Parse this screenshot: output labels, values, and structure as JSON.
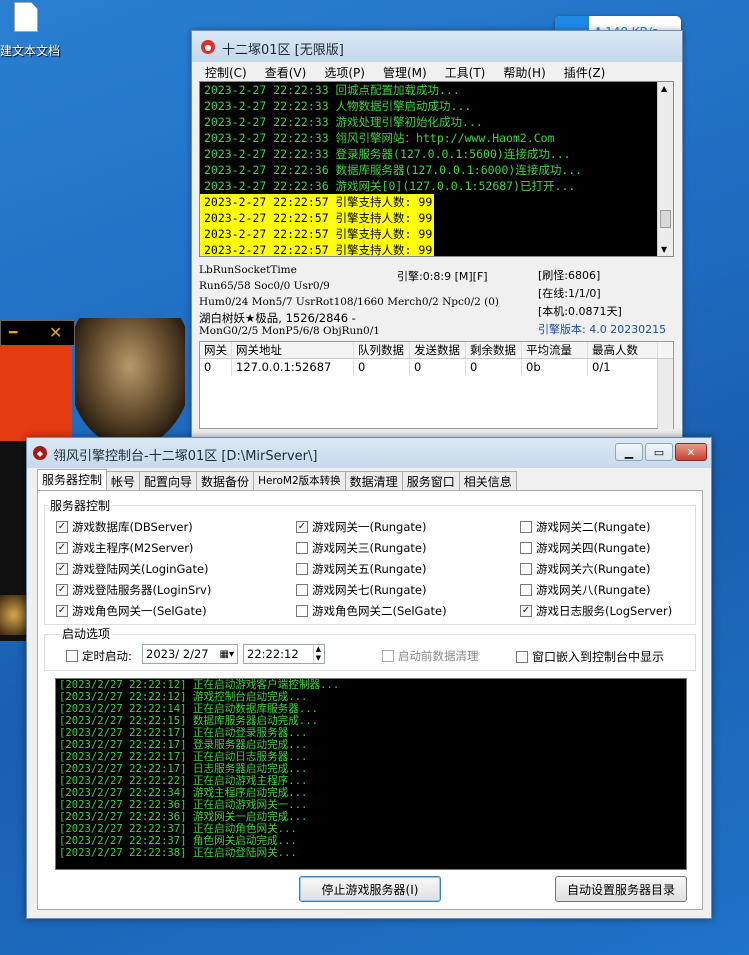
{
  "desktop": {
    "icon_label": "建文本文档",
    "icon": "text-file-icon"
  },
  "speed_widget": {
    "value": "148 KB/s",
    "icon": "cloud-icon",
    "arrow_icon": "download-arrow-icon"
  },
  "win1": {
    "title": "十二塚01区 [无限版]",
    "menu": [
      "控制(C)",
      "查看(V)",
      "选项(P)",
      "管理(M)",
      "工具(T)",
      "帮助(H)",
      "插件(Z)"
    ],
    "log": [
      {
        "text": "2023-2-27 22:22:33 回城点配置加载成功...",
        "hl": false
      },
      {
        "text": "2023-2-27 22:22:33 人物数据引擎启动成功...",
        "hl": false
      },
      {
        "text": "2023-2-27 22:22:33 游戏处理引擎初始化成功...",
        "hl": false
      },
      {
        "text": "2023-2-27 22:22:33 翎风引擎网站：http://www.Haom2.Com",
        "hl": false
      },
      {
        "text": "2023-2-27 22:22:33 登录服务器(127.0.0.1:5600)连接成功...",
        "hl": false
      },
      {
        "text": "2023-2-27 22:22:36 数据库服务器(127.0.0.1:6000)连接成功...",
        "hl": false
      },
      {
        "text": "2023-2-27 22:22:36 游戏网关[0](127.0.0.1:52687)已打开...",
        "hl": false
      },
      {
        "text": "2023-2-27 22:22:57 引擎支持人数: 99",
        "hl": true
      },
      {
        "text": "2023-2-27 22:22:57 引擎支持人数: 99",
        "hl": true
      },
      {
        "text": "2023-2-27 22:22:57 引擎支持人数: 99",
        "hl": true
      },
      {
        "text": "2023-2-27 22:22:57 引擎支持人数: 99",
        "hl": true
      }
    ],
    "status": {
      "run_socket": "LbRunSocketTime",
      "run": "Run65/58 Soc0/0 Usr0/9",
      "hum": "Hum0/24 Mon5/7 UsrRot108/1660 Merch0/2 Npc0/2 (0)",
      "map": "湖白树妖★极品, 1526/2846 -",
      "mongo": "MonG0/2/5 MonP5/6/8 ObjRun0/1",
      "engine_ratio": "引擎:0:8:9 [M][F]",
      "monster": "[刷怪:6806]",
      "online": "[在线:1/1/0]",
      "local": "[本机:0.0871天]",
      "version": "引擎版本: 4.0 20230215"
    },
    "gateway_table": {
      "headers": [
        "网关",
        "网关地址",
        "队列数据",
        "发送数据",
        "剩余数据",
        "平均流量",
        "最高人数"
      ],
      "rows": [
        [
          "0",
          "127.0.0.1:52687",
          "0",
          "0",
          "0",
          "0b",
          "0/1"
        ]
      ]
    }
  },
  "win2": {
    "title": "翎风引擎控制台-十二塚01区 [D:\\MirServer\\]",
    "tabs": [
      "服务器控制",
      "帐号",
      "配置向导",
      "数据备份",
      "HeroM2版本转换",
      "数据清理",
      "服务窗口",
      "相关信息"
    ],
    "group_server": "服务器控制",
    "checkboxes": [
      {
        "label": "游戏数据库(DBServer)",
        "checked": true
      },
      {
        "label": "游戏网关一(Rungate)",
        "checked": true
      },
      {
        "label": "游戏网关二(Rungate)",
        "checked": false
      },
      {
        "label": "游戏主程序(M2Server)",
        "checked": true
      },
      {
        "label": "游戏网关三(Rungate)",
        "checked": false
      },
      {
        "label": "游戏网关四(Rungate)",
        "checked": false
      },
      {
        "label": "游戏登陆网关(LoginGate)",
        "checked": true
      },
      {
        "label": "游戏网关五(Rungate)",
        "checked": false
      },
      {
        "label": "游戏网关六(Rungate)",
        "checked": false
      },
      {
        "label": "游戏登陆服务器(LoginSrv)",
        "checked": true
      },
      {
        "label": "游戏网关七(Rungate)",
        "checked": false
      },
      {
        "label": "游戏网关八(Rungate)",
        "checked": false
      },
      {
        "label": "游戏角色网关一(SelGate)",
        "checked": true
      },
      {
        "label": "游戏角色网关二(SelGate)",
        "checked": false
      },
      {
        "label": "游戏日志服务(LogServer)",
        "checked": true
      }
    ],
    "group_start": "启动选项",
    "timed_start": "定时启动:",
    "date_value": "2023/ 2/27",
    "time_value": "22:22:12",
    "pre_clean": "启动前数据清理",
    "embed_label": "窗口嵌入到控制台中显示",
    "log": [
      "[2023/2/27 22:22:12] 正在启动游戏客户端控制器...",
      "[2023/2/27 22:22:12] 游戏控制台启动完成...",
      "[2023/2/27 22:22:14] 正在启动数据库服务器...",
      "[2023/2/27 22:22:15] 数据库服务器启动完成...",
      "[2023/2/27 22:22:17] 正在启动登录服务器...",
      "[2023/2/27 22:22:17] 登录服务器启动完成...",
      "[2023/2/27 22:22:17] 正在启动日志服务器...",
      "[2023/2/27 22:22:17] 日志服务器启动完成...",
      "[2023/2/27 22:22:22] 正在启动游戏主程序...",
      "[2023/2/27 22:22:34] 游戏主程序启动完成...",
      "[2023/2/27 22:22:36] 正在启动游戏网关一...",
      "[2023/2/27 22:22:36] 游戏网关一启动完成...",
      "[2023/2/27 22:22:37] 正在启动角色网关...",
      "[2023/2/27 22:22:37] 角色网关启动完成...",
      "[2023/2/27 22:22:38] 正在启动登陆网关..."
    ],
    "stop_button": "停止游戏服务器(I)",
    "auto_dir_button": "自动设置服务器目录"
  }
}
